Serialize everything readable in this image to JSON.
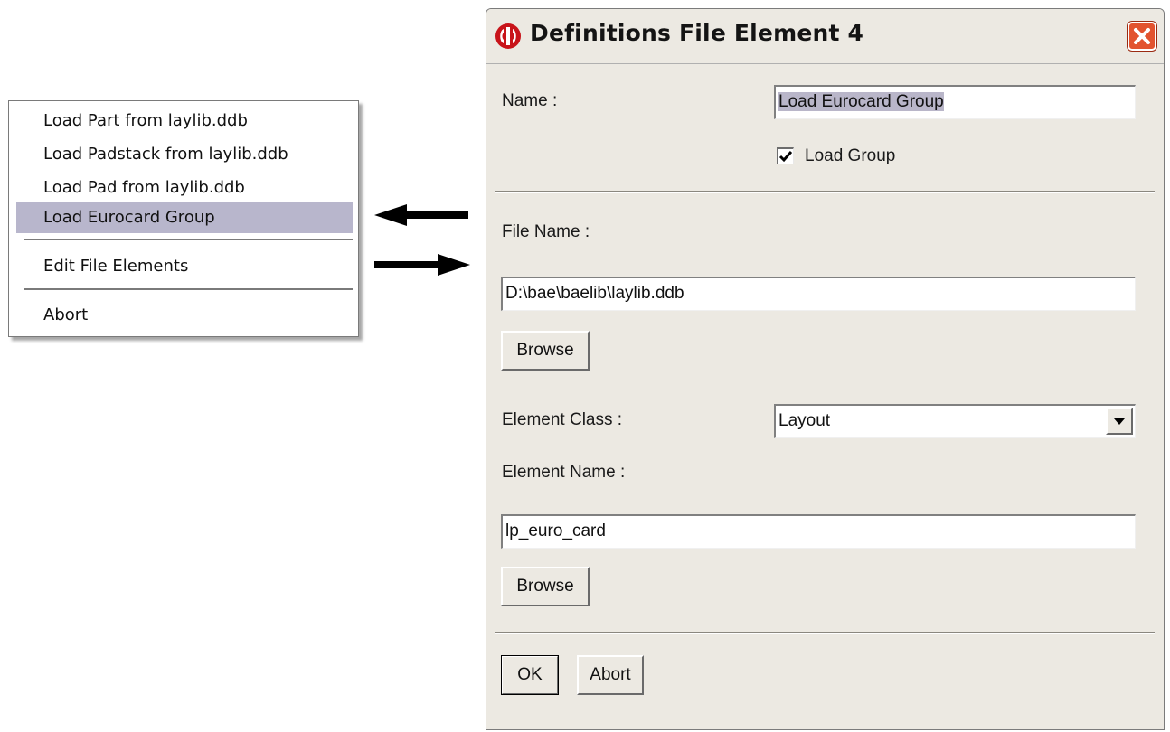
{
  "menu": {
    "items": [
      {
        "label": "Load Part from laylib.ddb"
      },
      {
        "label": "Load Padstack from laylib.ddb"
      },
      {
        "label": "Load Pad from laylib.ddb"
      },
      {
        "label": "Load Eurocard Group",
        "selected": true
      },
      {
        "label": "Edit File Elements"
      },
      {
        "label": "Abort"
      }
    ]
  },
  "dialog": {
    "title": "Definitions File Element 4",
    "name_label": "Name :",
    "name_value": "Load Eurocard Group",
    "load_group_label": "Load Group",
    "load_group_checked": true,
    "file_name_label": "File Name :",
    "file_name_value": "D:\\bae\\baelib\\laylib.ddb",
    "browse_label": "Browse",
    "element_class_label": "Element Class :",
    "element_class_value": "Layout",
    "element_name_label": "Element Name :",
    "element_name_value": "lp_euro_card",
    "browse2_label": "Browse",
    "ok_label": "OK",
    "abort_label": "Abort"
  },
  "colors": {
    "dialog_bg": "#ece9e2",
    "menu_selected": "#b8b6cc",
    "close_button": "#e2532f"
  },
  "icons": [
    "app-icon",
    "close-icon",
    "checkmark-icon",
    "dropdown-arrow-icon",
    "arrow-left-icon",
    "arrow-right-icon"
  ]
}
